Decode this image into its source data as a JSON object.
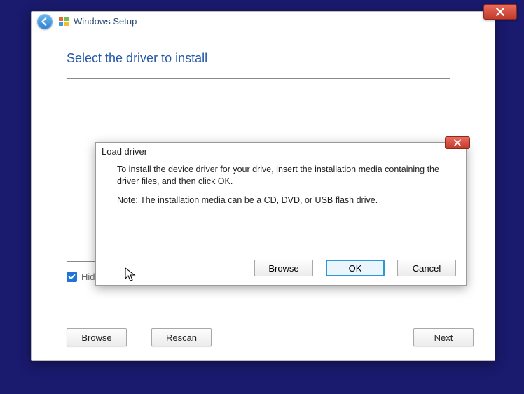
{
  "window": {
    "title": "Windows Setup"
  },
  "main": {
    "heading": "Select the driver to install",
    "hide_checkbox_label": "Hide drivers that aren't compatible with this computer's hardware.",
    "browse_btn": "Browse",
    "browse_u": "B",
    "rescan_btn": "escan",
    "rescan_u": "R",
    "next_btn": "ext",
    "next_u": "N"
  },
  "dialog": {
    "title": "Load driver",
    "body_line1": "To install the device driver for your drive, insert the installation media containing the driver files, and then click OK.",
    "body_line2": "Note: The installation media can be a CD, DVD, or USB flash drive.",
    "browse_btn": "rowse",
    "browse_u": "B",
    "ok_btn": "OK",
    "cancel_btn": "Cancel"
  }
}
